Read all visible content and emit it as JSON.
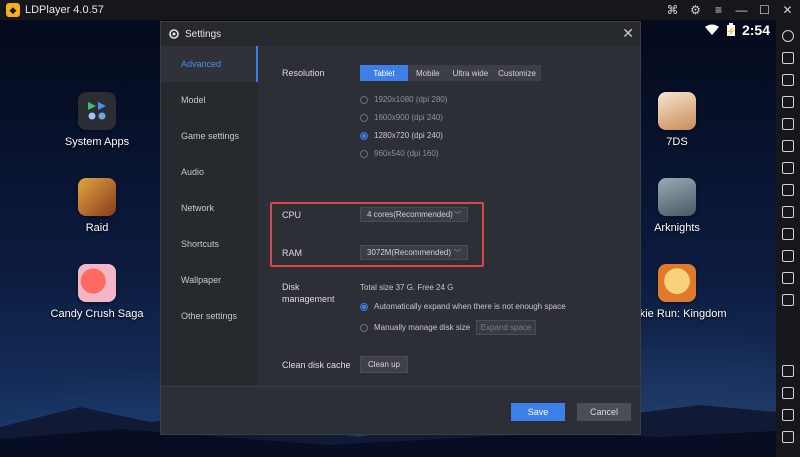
{
  "window": {
    "title": "LDPlayer 4.0.57",
    "controls": [
      "gamepad-icon",
      "settings-icon",
      "minimize-icon",
      "maximize-icon",
      "close-icon"
    ]
  },
  "status": {
    "time": "2:54"
  },
  "desktop": {
    "apps": [
      {
        "label": "System Apps",
        "icon": "system-apps-icon",
        "color": "#2a2d33"
      },
      {
        "label": "Raid",
        "icon": "raid-icon",
        "color": "#8a3b1c"
      },
      {
        "label": "Candy Crush Saga",
        "icon": "candy-crush-icon",
        "color": "#d9463e"
      },
      {
        "label": "7DS",
        "icon": "7ds-icon",
        "color": "#e8d9c4"
      },
      {
        "label": "Arknights",
        "icon": "arknights-icon",
        "color": "#6b7a86"
      },
      {
        "label": "ookie Run: Kingdom",
        "icon": "cookie-run-icon",
        "color": "#e8a93a"
      }
    ]
  },
  "dialog": {
    "title": "Settings",
    "nav": [
      "Advanced",
      "Model",
      "Game settings",
      "Audio",
      "Network",
      "Shortcuts",
      "Wallpaper",
      "Other settings"
    ],
    "active_nav": "Advanced",
    "resolution": {
      "label": "Resolution",
      "tabs": [
        "Tablet",
        "Mobile",
        "Ultra wide",
        "Customize"
      ],
      "active_tab": "Tablet",
      "options": [
        "1920x1080  (dpi 280)",
        "1600x900  (dpi 240)",
        "1280x720  (dpi 240)",
        "960x540  (dpi 160)"
      ],
      "selected_index": 2
    },
    "cpu": {
      "label": "CPU",
      "value": "4 cores(Recommended)"
    },
    "ram": {
      "label": "RAM",
      "value": "3072M(Recommended)"
    },
    "disk": {
      "label_line1": "Disk",
      "label_line2": "management",
      "info": "Total size 37 G.  Free 24 G",
      "auto_option": "Automatically expand when there is not enough space",
      "manual_option": "Manually manage disk size",
      "expand_button": "Expand space"
    },
    "cache": {
      "label": "Clean disk cache",
      "button": "Clean up"
    },
    "footer": {
      "save": "Save",
      "cancel": "Cancel"
    },
    "accent_color": "#3d7fe8",
    "highlight_color": "#d84848"
  }
}
